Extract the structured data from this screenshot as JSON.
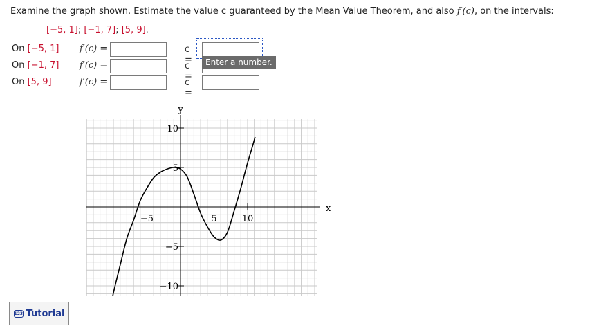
{
  "question": {
    "text_before": "Examine the graph shown. Estimate the value c guaranteed by the Mean Value Theorem, and also ",
    "fprime_c": "f′(c)",
    "text_after": ", on the intervals:"
  },
  "intervals_line": [
    "[−5, 1]",
    "[−1, 7]",
    "[5, 9]"
  ],
  "rows": [
    {
      "label_prefix": "On ",
      "interval": "[−5, 1]",
      "fprime_label": "f′(c) =",
      "c_label": "c =",
      "fprime_value": "",
      "c_value": ""
    },
    {
      "label_prefix": "On ",
      "interval": "[−1, 7]",
      "fprime_label": "f′(c) =",
      "c_label": "c =",
      "fprime_value": "",
      "c_value": ""
    },
    {
      "label_prefix": "On ",
      "interval": "[5, 9]",
      "fprime_label": "f′(c) =",
      "c_label": "c =",
      "fprime_value": "",
      "c_value": ""
    }
  ],
  "tooltip": "Enter a number.",
  "tutorial_label": "Tutorial",
  "tutorial_icon_text": "123",
  "colors": {
    "interval_red": "#c8102e",
    "tooltip_bg": "#6b6b6b",
    "focus": "#2b57c4"
  },
  "chart_data": {
    "type": "line",
    "xlabel": "x",
    "ylabel": "y",
    "xlim": [
      -11,
      16
    ],
    "ylim": [
      -11,
      11
    ],
    "x_ticks": [
      -5,
      5,
      10
    ],
    "y_ticks": [
      10,
      5,
      -5,
      -10
    ],
    "grid": true,
    "series": [
      {
        "x": [
          -11,
          -10,
          -9,
          -8,
          -7,
          -6,
          -5,
          -4,
          -3,
          -2,
          -1,
          0,
          1,
          2,
          3,
          4,
          5,
          6,
          7,
          8,
          9,
          10,
          11,
          12
        ],
        "y": [
          -14.8,
          -10.9,
          -7.4,
          -4.0,
          -1.7,
          0.8,
          2.4,
          3.7,
          4.4,
          4.8,
          5.0,
          4.8,
          3.8,
          1.6,
          -0.8,
          -2.5,
          -3.8,
          -4.2,
          -3.2,
          -0.5,
          2.4,
          5.6,
          8.5,
          12.0
        ]
      }
    ]
  }
}
